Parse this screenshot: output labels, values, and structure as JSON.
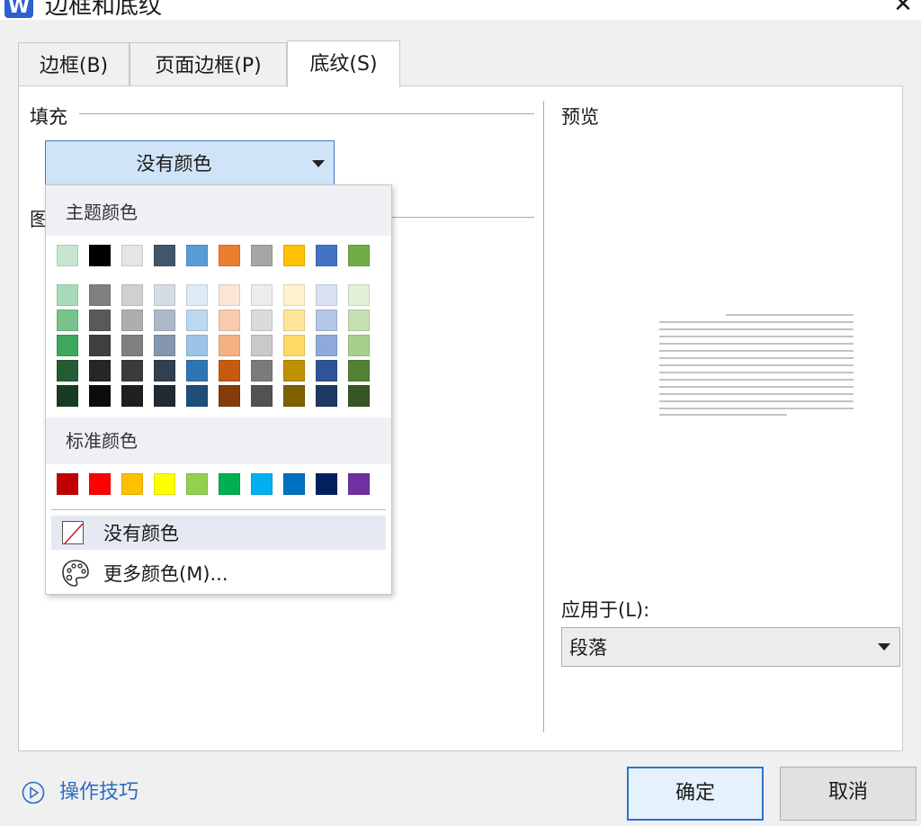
{
  "window": {
    "title": "边框和底纹",
    "icon": "wps-writer-icon",
    "close_glyph": "✕"
  },
  "tabs": [
    {
      "label": "边框(B)",
      "active": false
    },
    {
      "label": "页面边框(P)",
      "active": false
    },
    {
      "label": "底纹(S)",
      "active": true
    }
  ],
  "fill": {
    "group_label": "填充",
    "selected": "没有颜色",
    "pattern_group_label_partial": "图"
  },
  "color_popup": {
    "theme_label": "主题颜色",
    "theme_top_row": [
      "#c6e6cf",
      "#000000",
      "#e3e5e8",
      "#44546a",
      "#5b9bd5",
      "#ed7d31",
      "#a5a5a5",
      "#ffc000",
      "#4472c4",
      "#70ad47"
    ],
    "theme_shades": [
      [
        "#a9dab7",
        "#7f7f7f",
        "#d0d0d0",
        "#d6dce4",
        "#deebf6",
        "#fbe5d5",
        "#ededed",
        "#fff2cc",
        "#d9e2f3",
        "#e2efd9"
      ],
      [
        "#76c38b",
        "#595959",
        "#aeaeae",
        "#adb9ca",
        "#bdd7ee",
        "#f7cbac",
        "#dbdbdb",
        "#fee699",
        "#b4c6e7",
        "#c5e0b3"
      ],
      [
        "#3ea75d",
        "#3f3f3f",
        "#808080",
        "#8496b0",
        "#9dc3e6",
        "#f4b183",
        "#c9c9c9",
        "#ffd965",
        "#8eaadb",
        "#a8d08d"
      ],
      [
        "#245c34",
        "#262626",
        "#3b3b3b",
        "#323f4f",
        "#2e75b5",
        "#c55a11",
        "#7b7b7b",
        "#bf9000",
        "#2f5496",
        "#538135"
      ],
      [
        "#163d22",
        "#0c0c0c",
        "#1f1f1f",
        "#222a35",
        "#1f4e79",
        "#833c0b",
        "#525252",
        "#7f6000",
        "#1f3864",
        "#375623"
      ]
    ],
    "standard_label": "标准颜色",
    "standard_colors": [
      "#c00000",
      "#ff0000",
      "#ffc000",
      "#ffff00",
      "#92d050",
      "#00b050",
      "#00b0f0",
      "#0070c0",
      "#002060",
      "#7030a0"
    ],
    "no_color_label": "没有颜色",
    "more_colors_label": "更多颜色(M)..."
  },
  "preview": {
    "label": "预览"
  },
  "apply_to": {
    "label": "应用于(L):",
    "selected": "段落"
  },
  "footer": {
    "tips_label": "操作技巧",
    "ok_label": "确定",
    "cancel_label": "取消"
  },
  "accent_color": "#2f72c8",
  "icons": [
    "wps-writer-icon",
    "close-icon",
    "chevron-down-icon",
    "no-color-icon",
    "palette-icon",
    "play-circle-icon"
  ]
}
